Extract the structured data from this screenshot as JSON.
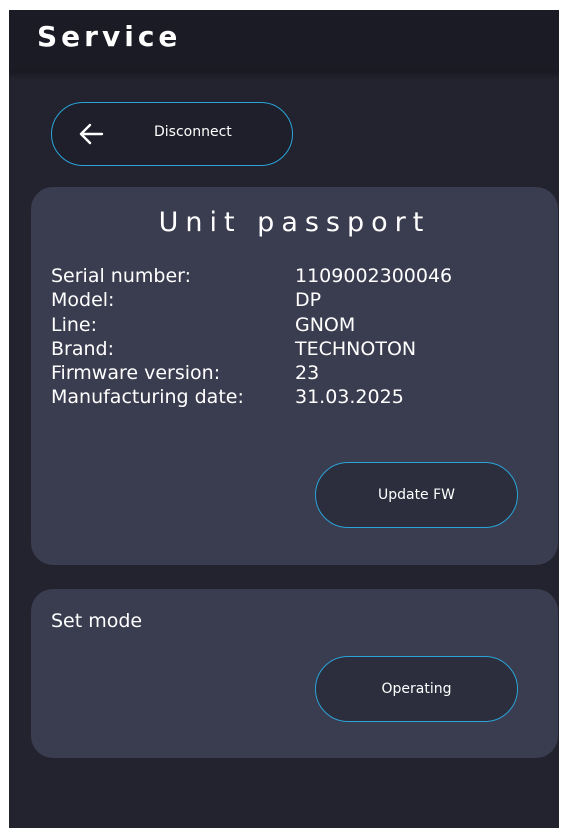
{
  "header": {
    "title": "Service"
  },
  "disconnect": {
    "label": "Disconnect",
    "icon": "arrow-left-icon"
  },
  "passport": {
    "title": "Unit passport",
    "fields": [
      {
        "label": "Serial number:",
        "value": "1109002300046"
      },
      {
        "label": "Model:",
        "value": "DP"
      },
      {
        "label": "Line:",
        "value": "GNOM"
      },
      {
        "label": "Brand:",
        "value": "TECHNOTON"
      },
      {
        "label": "Firmware version:",
        "value": "23"
      },
      {
        "label": "Manufacturing date:",
        "value": "31.03.2025"
      }
    ],
    "update_button": "Update FW"
  },
  "mode": {
    "label": "Set mode",
    "button": "Operating"
  },
  "colors": {
    "background": "#23232f",
    "header": "#1b1b25",
    "card": "#3a3c4f",
    "accent": "#2aa3d6",
    "text": "#ffffff"
  }
}
